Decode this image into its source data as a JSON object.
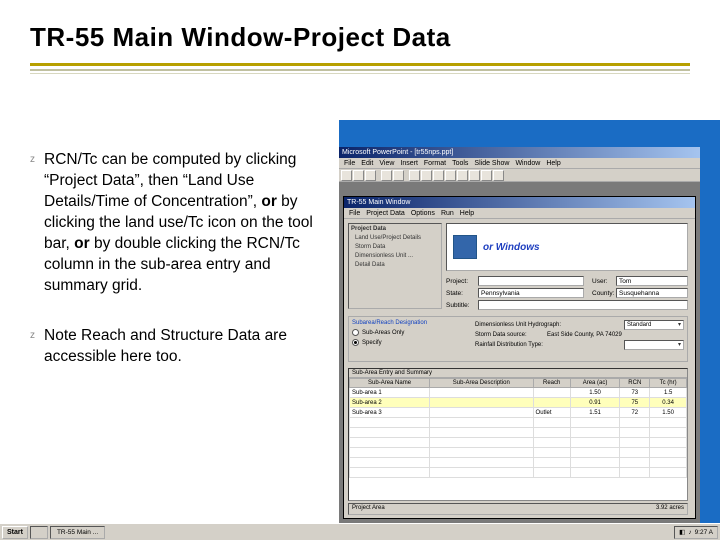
{
  "title": "TR-55 Main Window-Project Data",
  "bullets": [
    {
      "pre": "RCN/Tc can be computed by clicking “Project Data”, then “Land Use Details/Time of Concentration”, ",
      "b1": "or",
      "mid": " by clicking the land use/Tc icon on the tool bar, ",
      "b2": "or",
      "post": " by double clicking the RCN/Tc column in the sub-area entry and summary grid."
    },
    {
      "text": "Note Reach and Structure Data are accessible here too."
    }
  ],
  "app": {
    "titlebar": "Microsoft PowerPoint - [tr55nps.ppt]",
    "menus": [
      "File",
      "Edit",
      "View",
      "Insert",
      "Format",
      "Tools",
      "Slide Show",
      "Window",
      "Help"
    ],
    "inner_title": "TR-55 Main Window",
    "inner_menus": [
      "File",
      "Project Data",
      "Options",
      "Run",
      "Help"
    ],
    "left_panel": {
      "title": "Project Data",
      "items": [
        "Land Use/Project Details",
        "Storm Data",
        "Dimensionless Unit ...",
        "Detail Data"
      ]
    },
    "banner": "or Windows",
    "fields": {
      "project_l": "Project:",
      "project_v": "",
      "user_l": "User:",
      "user_v": "Tom",
      "state_l": "State:",
      "state_v": "Pennsylvania",
      "county_l": "County:",
      "county_v": "Susquehanna",
      "subtitle_l": "Subtitle:",
      "subtitle_v": ""
    },
    "mid": {
      "left_title": "Subarea/Reach Designation",
      "r1": "Sub-Areas Only",
      "r2": "Specify",
      "right_l1": "Dimensionless Unit Hydrograph:",
      "dd1": "Standard",
      "right_l2": "Storm Data source:",
      "right_l2v": "East Side County, PA  74029",
      "right_l3": "Rainfall Distribution Type:",
      "dd2": ""
    },
    "grid": {
      "title": "Sub-Area Entry and Summary",
      "headers": [
        "Sub-Area Name",
        "Sub-Area Description",
        "Reach",
        "Area (ac)",
        "RCN",
        "Tc (hr)"
      ],
      "rows": [
        [
          "Sub-area 1",
          "",
          "",
          "1.50",
          "73",
          "1.5"
        ],
        [
          "Sub-area 2",
          "",
          "",
          "0.91",
          "75",
          "0.34"
        ],
        [
          "Sub-area 3",
          "",
          "Outlet",
          "1.51",
          "72",
          "1.50"
        ]
      ]
    },
    "status_left": "Project Area",
    "status_right": "3.92 acres",
    "taskbar": {
      "start": "Start",
      "items": [
        "",
        "TR-55 Main ..."
      ],
      "clock": "9:27 A"
    }
  }
}
